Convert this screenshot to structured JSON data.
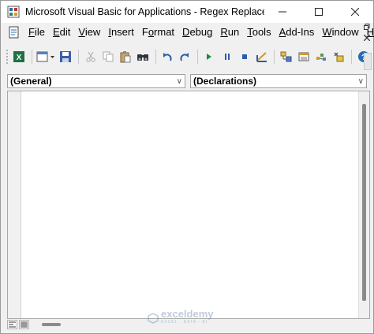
{
  "window": {
    "title": "Microsoft Visual Basic for Applications - Regex Replace.xlsm - [...",
    "controls": {
      "minimize": "minimize-icon",
      "maximize": "maximize-icon",
      "close": "close-icon"
    }
  },
  "menubar": {
    "items": [
      {
        "label": "File",
        "ul": "F",
        "rest": "ile"
      },
      {
        "label": "Edit",
        "ul": "E",
        "rest": "dit"
      },
      {
        "label": "View",
        "ul": "V",
        "rest": "iew"
      },
      {
        "label": "Insert",
        "ul": "I",
        "rest": "nsert"
      },
      {
        "label": "Format",
        "ul": "o",
        "pre": "F",
        "rest": "rmat"
      },
      {
        "label": "Debug",
        "ul": "D",
        "rest": "ebug"
      },
      {
        "label": "Run",
        "ul": "R",
        "rest": "un"
      },
      {
        "label": "Tools",
        "ul": "T",
        "rest": "ools"
      },
      {
        "label": "Add-Ins",
        "ul": "A",
        "rest": "dd-Ins"
      },
      {
        "label": "Window",
        "ul": "W",
        "rest": "indow"
      },
      {
        "label": "Help",
        "ul": "H",
        "rest": "elp"
      }
    ]
  },
  "toolbar": {
    "buttons": [
      "view-excel-icon",
      "insert-module-icon",
      "save-icon",
      "cut-icon",
      "copy-icon",
      "paste-icon",
      "find-icon",
      "undo-icon",
      "redo-icon",
      "run-icon",
      "break-icon",
      "reset-icon",
      "design-mode-icon",
      "project-explorer-icon",
      "properties-window-icon",
      "object-browser-icon",
      "toolbox-icon",
      "help-icon"
    ]
  },
  "code_window": {
    "object_combo": "(General)",
    "procedure_combo": "(Declarations)"
  },
  "watermark": {
    "brand": "exceldemy",
    "tagline": "EXCEL · DATA · BI"
  },
  "colors": {
    "titlebar_bg": "#ffffff",
    "chrome_bg": "#f0f0f0",
    "editor_bg": "#ffffff"
  }
}
